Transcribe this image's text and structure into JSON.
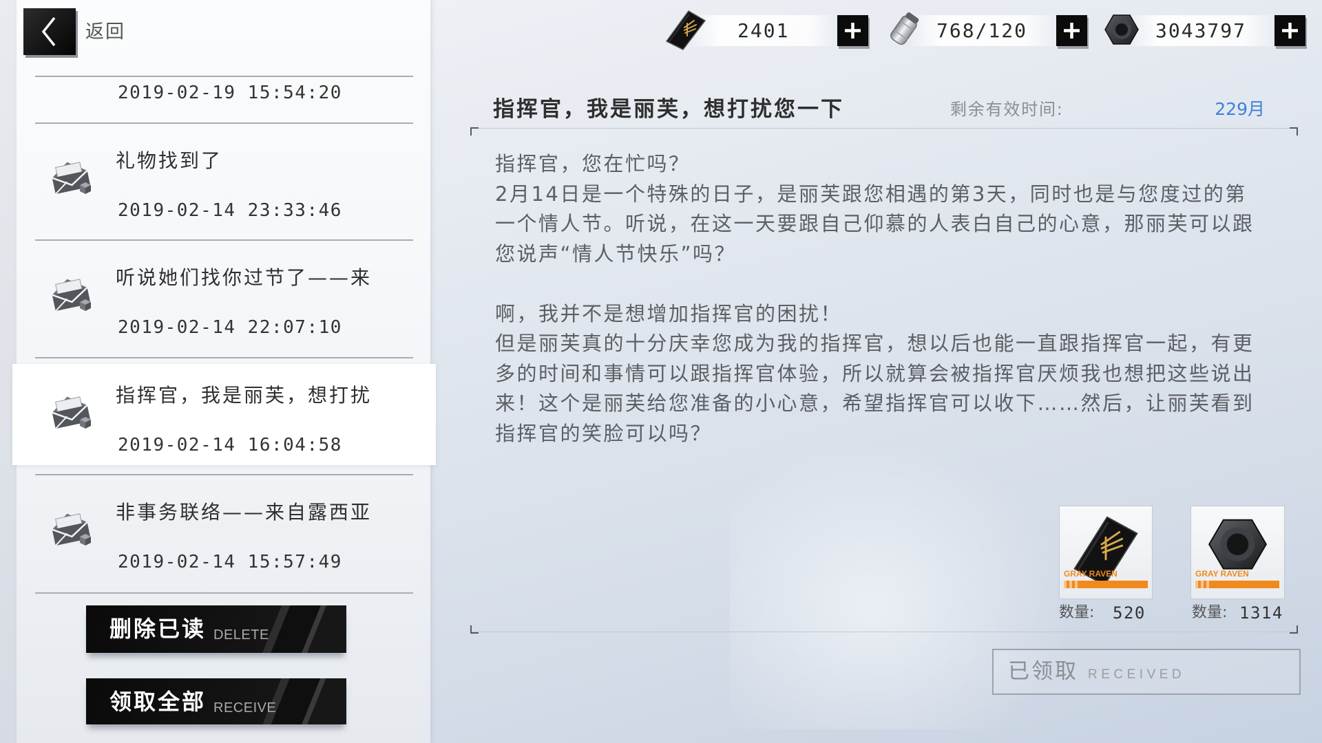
{
  "nav": {
    "back_label": "返回"
  },
  "resources": [
    {
      "icon": "black-card-icon",
      "value": "2401"
    },
    {
      "icon": "serum-icon",
      "value": "768/120"
    },
    {
      "icon": "cog-icon",
      "value": "3043797"
    }
  ],
  "mail_list": {
    "partial_item": {
      "date": "2019-02-19 15:54:20"
    },
    "items": [
      {
        "icon": "opened-mail-icon",
        "title": "礼物找到了",
        "date": "2019-02-14 23:33:46",
        "selected": false
      },
      {
        "icon": "opened-mail-icon",
        "title": "听说她们找你过节了——来",
        "date": "2019-02-14 22:07:10",
        "selected": false
      },
      {
        "icon": "opened-mail-icon",
        "title": "指挥官，我是丽芙，想打扰",
        "date": "2019-02-14 16:04:58",
        "selected": true
      },
      {
        "icon": "opened-mail-icon",
        "title": "非事务联络——来自露西亚",
        "date": "2019-02-14 15:57:49",
        "selected": false
      }
    ]
  },
  "actions": {
    "delete_read": {
      "label": "删除已读",
      "sub": "DELETE"
    },
    "receive_all": {
      "label": "领取全部",
      "sub": "RECEIVE"
    }
  },
  "mail": {
    "title": "指挥官，我是丽芙，想打扰您一下",
    "validity_label": "剩余有效时间:",
    "validity_value": "229月",
    "body": [
      [
        "指挥官，您在忙吗？",
        "2月14日是一个特殊的日子，是丽芙跟您相遇的第3天，同时也是与您度过的第",
        "一个情人节。听说，在这一天要跟自己仰慕的人表白自己的心意，那丽芙可以跟",
        "您说声“情人节快乐”吗？"
      ],
      [
        "啊，我并不是想增加指挥官的困扰！",
        "但是丽芙真的十分庆幸您成为我的指挥官，想以后也能一直跟指挥官一起，有更",
        "多的时间和事情可以跟指挥官体验，所以就算会被指挥官厌烦我也想把这些说出",
        "来！这个是丽芙给您准备的小心意，希望指挥官可以收下……然后，让丽芙看到",
        "指挥官的笑脸可以吗？"
      ]
    ],
    "attachments": [
      {
        "icon": "black-card-icon",
        "badge": "GRAY RAVEN",
        "quantity_label": "数量:",
        "quantity": "520"
      },
      {
        "icon": "cog-icon",
        "badge": "GRAY RAVEN",
        "quantity_label": "数量:",
        "quantity": "1314"
      }
    ],
    "claim": {
      "label": "已领取",
      "sub": "RECEIVED"
    }
  },
  "colors": {
    "accent_blue": "#3f7fd9",
    "badge_orange": "#f08a1c",
    "button_black": "#0c0c0c"
  }
}
